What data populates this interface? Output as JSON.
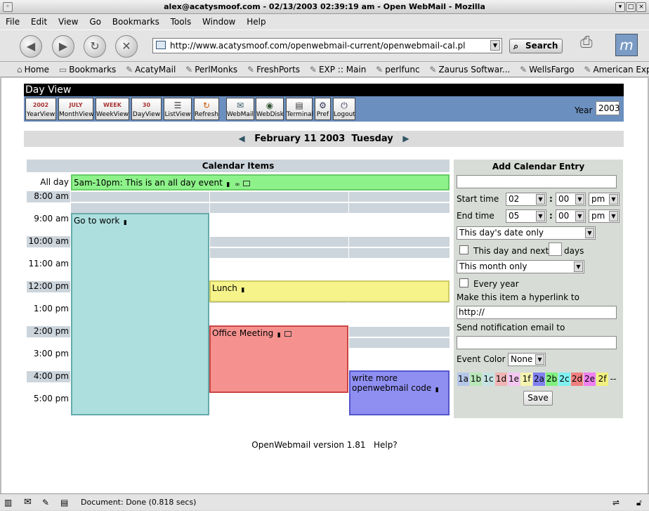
{
  "window": {
    "title": "alex@acatysmoof.com - 02/13/2003 02:39:19 am - Open WebMail - Mozilla"
  },
  "menu": [
    "File",
    "Edit",
    "View",
    "Go",
    "Bookmarks",
    "Tools",
    "Window",
    "Help"
  ],
  "nav": {
    "url": "http://www.acatysmoof.com/openwebmail-current/openwebmail-cal.pl",
    "search_label": "Search"
  },
  "bookmarks": [
    "Home",
    "Bookmarks",
    "AcatyMail",
    "PerlMonks",
    "FreshPorts",
    "EXP :: Main",
    "perlfunc",
    "Zaurus Softwar...",
    "WellsFargo",
    "American Expr..."
  ],
  "page": {
    "title": "Day View",
    "toolbar": [
      "YearView",
      "MonthView",
      "WeekView",
      "DayView",
      "ListView",
      "Refresh",
      "WebMail",
      "WebDisk",
      "Terminal",
      "Pref",
      "Logout"
    ],
    "toolbar_icon_text": [
      "2002",
      "JULY",
      "WEEK",
      "30",
      "",
      "",
      "",
      "",
      "",
      "",
      ""
    ],
    "year_label": "Year",
    "year_value": "2003",
    "date": "February 11 2003  Tuesday",
    "calendar_header": "Calendar Items",
    "allday_label": "All day",
    "times": [
      "8:00 am",
      "9:00 am",
      "10:00 am",
      "11:00 am",
      "12:00 pm",
      "1:00 pm",
      "2:00 pm",
      "3:00 pm",
      "4:00 pm",
      "5:00 pm"
    ],
    "events": {
      "allday": "5am-10pm: This is an all day event",
      "work": "Go to work",
      "lunch": "Lunch",
      "meeting": "Office Meeting",
      "write": "write more openwebmail code"
    },
    "event_colors": {
      "allday": "#8ef28a",
      "work": "#addfdf",
      "lunch": "#f5f38a",
      "meeting": "#f5928f",
      "write": "#8f8ff2"
    }
  },
  "add_entry": {
    "title": "Add Calendar Entry",
    "start_label": "Start time",
    "end_label": "End time",
    "start_hour": "02",
    "start_min": "00",
    "start_ampm": "pm",
    "end_hour": "05",
    "end_min": "00",
    "end_ampm": "pm",
    "date_scope": "This day's date only",
    "next_days_label": "This day and next",
    "days_label": "days",
    "month_scope": "This month only",
    "every_year_label": "Every year",
    "hyperlink_label": "Make this item a hyperlink to",
    "hyperlink_value": "http://",
    "email_label": "Send notification email to",
    "color_label": "Event Color",
    "color_value": "None",
    "swatches": [
      "1a",
      "1b",
      "1c",
      "1d",
      "1e",
      "1f",
      "2a",
      "2b",
      "2c",
      "2d",
      "2e",
      "2f",
      "--"
    ],
    "swatch_colors": [
      "#b5c7e8",
      "#b8e6b8",
      "#c6e3e3",
      "#f0b4b4",
      "#f5c6f0",
      "#f5f3b0",
      "#8080f0",
      "#80f080",
      "#80f0f0",
      "#f08080",
      "#f080f0",
      "#f0f080",
      ""
    ],
    "save_label": "Save"
  },
  "footer": {
    "version": "OpenWebmail version 1.81",
    "help": "Help?"
  },
  "status": {
    "text": "Document: Done (0.818 secs)"
  }
}
